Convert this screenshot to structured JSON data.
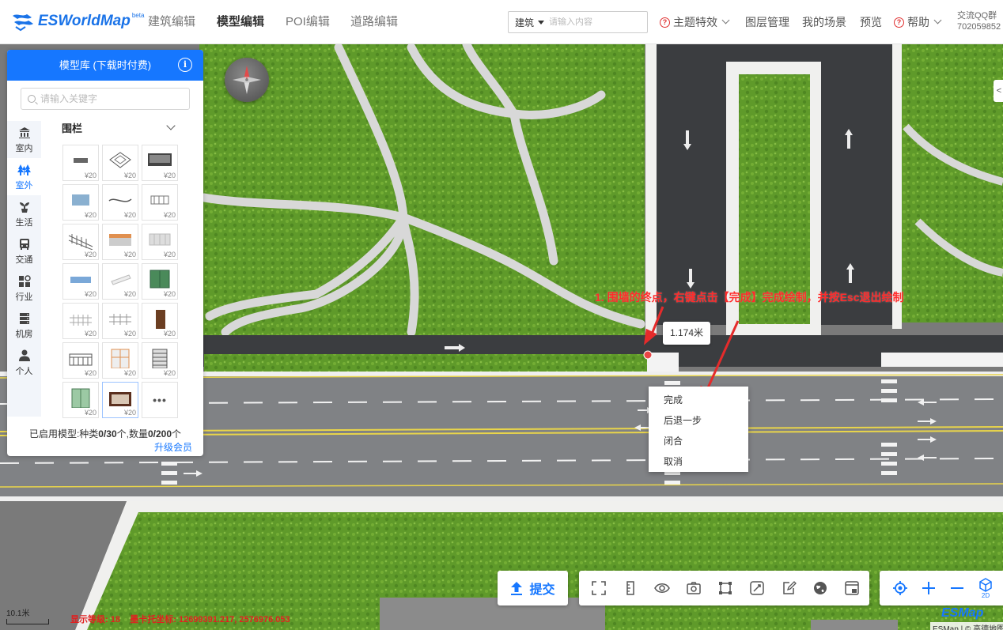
{
  "app": {
    "logo_text": "ESWorldMap",
    "logo_badge": "beta"
  },
  "nav": [
    {
      "label": "建筑编辑",
      "active": false
    },
    {
      "label": "模型编辑",
      "active": true
    },
    {
      "label": "POI编辑",
      "active": false
    },
    {
      "label": "道路编辑",
      "active": false
    }
  ],
  "search": {
    "category": "建筑",
    "placeholder": "请输入内容",
    "value": ""
  },
  "top_menu": {
    "theme": "主题特效",
    "layers": "图层管理",
    "my_scene": "我的场景",
    "preview": "预览",
    "help": "帮助",
    "qq_line1": "交流QQ群",
    "qq_line2": "702059852"
  },
  "panel": {
    "title": "模型库 (下载时付费)",
    "info_icon": "i",
    "search_placeholder": "请输入关键字",
    "categories": [
      {
        "label": "室内",
        "icon": "building-icon",
        "active": false
      },
      {
        "label": "室外",
        "icon": "trees-icon",
        "active": true
      },
      {
        "label": "生活",
        "icon": "plant-icon",
        "active": false
      },
      {
        "label": "交通",
        "icon": "bus-icon",
        "active": false
      },
      {
        "label": "行业",
        "icon": "grid-icon",
        "active": false
      },
      {
        "label": "机房",
        "icon": "server-icon",
        "active": false
      },
      {
        "label": "个人",
        "icon": "person-icon",
        "active": false
      }
    ],
    "group_title": "围栏",
    "price": "¥20",
    "more": "•••",
    "footer_prefix": "已启用模型:种类",
    "footer_kinds": "0/30",
    "footer_mid": "个,数量",
    "footer_count": "0/200",
    "footer_suffix": "个",
    "upgrade": "升级会员"
  },
  "annotation": "1. 围墙的终点，右键点击【完成】完成绘制，并按Esc退出绘制",
  "distance_label": "1.174米",
  "context_menu": [
    "完成",
    "后退一步",
    "闭合",
    "取消"
  ],
  "toolbar": {
    "submit": "提交",
    "tools": [
      "fullscreen-icon",
      "ruler-icon",
      "eye-icon",
      "camera-icon",
      "frame-icon",
      "measure-icon",
      "edit-icon",
      "globe-icon",
      "screenshot-icon"
    ],
    "zoom": [
      "locate-icon",
      "zoom-in-icon",
      "zoom-out-icon",
      "view-2d-icon"
    ],
    "view_mode": "2D"
  },
  "status": {
    "scale": "10.1米",
    "level_label": "显示等级:",
    "level": "18",
    "coord_label": "墨卡托坐标:",
    "coord": "12699391.217, 2576976.053"
  },
  "brand": "ESMap",
  "copyright": "ESMap | © 高德地图"
}
